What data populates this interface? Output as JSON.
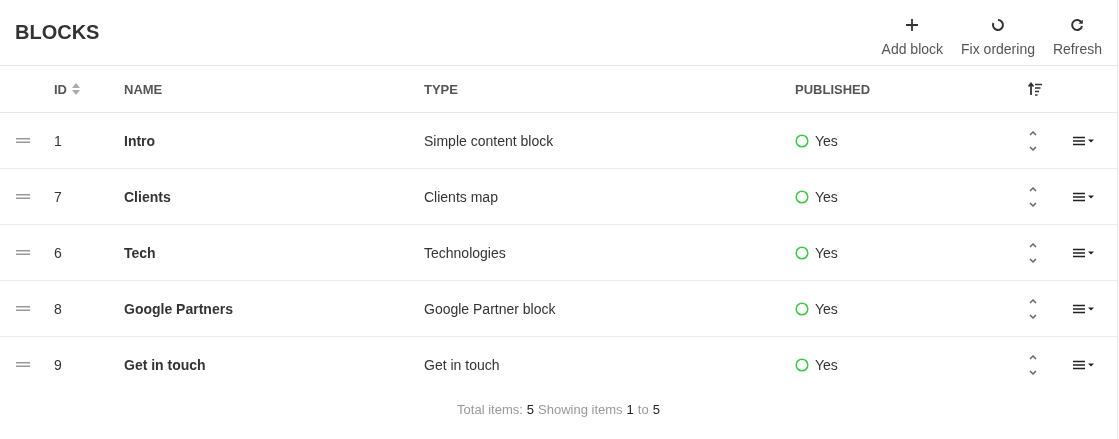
{
  "title": "BLOCKS",
  "actions": [
    {
      "kind": "add",
      "label": "Add block"
    },
    {
      "kind": "reorder",
      "label": "Fix ordering"
    },
    {
      "kind": "refresh",
      "label": "Refresh"
    }
  ],
  "table": {
    "columns": [
      {
        "label": "ID",
        "sortable": true
      },
      {
        "label": "NAME",
        "sortable": false
      },
      {
        "label": "TYPE",
        "sortable": false
      },
      {
        "label": "PUBLISHED",
        "sortable": false
      }
    ],
    "rows": [
      {
        "id": "1",
        "name": "Intro",
        "type": "Simple content block",
        "published": true,
        "published_label": "Yes"
      },
      {
        "id": "7",
        "name": "Clients",
        "type": "Clients map",
        "published": true,
        "published_label": "Yes"
      },
      {
        "id": "6",
        "name": "Tech",
        "type": "Technologies",
        "published": true,
        "published_label": "Yes"
      },
      {
        "id": "8",
        "name": "Google Partners",
        "type": "Google Partner block",
        "published": true,
        "published_label": "Yes"
      },
      {
        "id": "9",
        "name": "Get in touch",
        "type": "Get in touch",
        "published": true,
        "published_label": "Yes"
      }
    ]
  },
  "footer": [
    {
      "kind": "label",
      "text": "Total items:"
    },
    {
      "kind": "value",
      "text": "5"
    },
    {
      "kind": "label",
      "text": "Showing items"
    },
    {
      "kind": "value",
      "text": "1"
    },
    {
      "kind": "label",
      "text": "to"
    },
    {
      "kind": "value",
      "text": "5"
    }
  ]
}
